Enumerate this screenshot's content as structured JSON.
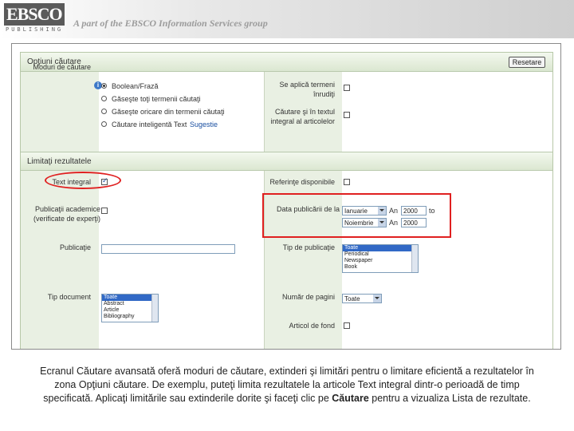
{
  "header": {
    "logo_name": "EBSCO",
    "logo_sub": "PUBLISHING",
    "tagline": "A part of the EBSCO Information Services group"
  },
  "search_options": {
    "title": "Opţiuni căutare",
    "reset_label": "Resetare",
    "search_modes_label": "Moduri de căutare",
    "modes": [
      {
        "label": "Boolean/Frază",
        "selected": true
      },
      {
        "label": "Găseşte toţi termenii căutaţi",
        "selected": false
      },
      {
        "label": "Găseşte oricare din termenii căutaţi",
        "selected": false
      },
      {
        "label": "Căutare inteligentă Text",
        "selected": false
      }
    ],
    "suggestion_link": "Sugestie",
    "related_terms_label": "Se aplică termeni înrudiţi",
    "fulltext_search_label": "Căutare şi în textul integral al articolelor"
  },
  "limiters": {
    "title": "Limitaţi rezultatele",
    "full_text_label": "Text integral",
    "full_text_checked": true,
    "references_label": "Referinţe disponibile",
    "peer_reviewed_label": "Publicaţii academice (verificate de experţi)",
    "date_published_label": "Data publicării de la",
    "date_from_month": "Ianuarie",
    "date_from_year": "2000",
    "date_to_month": "Noiembrie",
    "date_to_year": "2000",
    "year_label": "An",
    "to_label": "to",
    "publication_label": "Publicaţie",
    "publication_value": "",
    "pub_type_label": "Tip de publicaţie",
    "pub_types": [
      "Toate",
      "Periodical",
      "Newspaper",
      "Book"
    ],
    "doc_type_label": "Tip document",
    "doc_types": [
      "Toate",
      "Abstract",
      "Article",
      "Bibliography"
    ],
    "pages_label": "Număr de pagini",
    "pages_value": "Toate",
    "cover_story_label": "Articol de fond"
  },
  "caption": {
    "part1": "Ecranul Căutare avansată oferă moduri de căutare, extinderi şi limitări pentru o limitare eficientă a rezultatelor în zona Opţiuni căutare. De exemplu, puteţi limita rezultatele la articole Text integral dintr-o perioadă de timp specificată. Aplicaţi limitările sau extinderile dorite şi faceţi clic pe ",
    "bold": "Căutare",
    "part2": " pentru a vizualiza Lista de rezultate."
  },
  "colors": {
    "highlight_red": "#e02020",
    "section_green": "#dbe7d1",
    "link_blue": "#1a4fa0"
  }
}
